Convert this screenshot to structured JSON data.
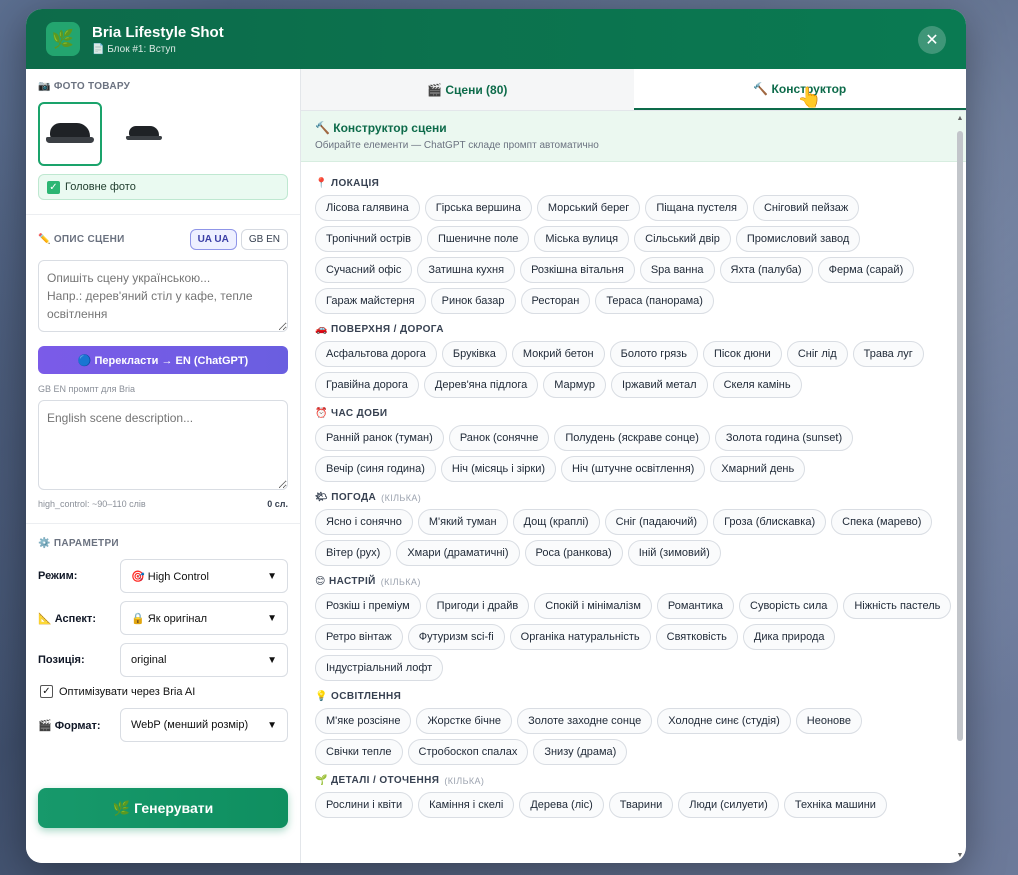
{
  "header": {
    "title": "Bria Lifestyle Shot",
    "subtitle": "📄 Блок #1: Вступ",
    "logo_icon": "🌿",
    "close_icon": "✕"
  },
  "left": {
    "photos_title": "📷 ФОТО ТОВАРУ",
    "main_photo_label": "Головне фото",
    "scene_title": "✏️ ОПИС СЦЕНИ",
    "lang_ua": "UA UA",
    "lang_en": "GB EN",
    "desc_placeholder": "Опишіть сцену українською...\nНапр.: дерев'яний стіл у кафе, тепле освітлення",
    "translate_label": "🔵 Перекласти → EN (ChatGPT)",
    "en_prompt_label": "GB EN промпт для Bria",
    "en_placeholder": "English scene description...",
    "hint": "high_control: ~90–110 слів",
    "word_count": "0 сл.",
    "params_title": "⚙️ ПАРАМЕТРИ",
    "mode_label": "Режим:",
    "mode_value": "🎯 High Control",
    "aspect_label": "📐 Аспект:",
    "aspect_value": "🔒 Як оригінал",
    "position_label": "Позиція:",
    "position_value": "original",
    "optimize_label": "Оптимізувати через Bria AI",
    "format_label": "🎬 Формат:",
    "format_value": "WebP (менший розмір)",
    "generate_label": "🌿 Генерувати"
  },
  "tabs": {
    "scenes": "🎬 Сцени (80)",
    "builder": "🔨 Конструктор"
  },
  "builder": {
    "title": "🔨 Конструктор сцени",
    "subtitle": "Обирайте елементи — ChatGPT складе промпт автоматично"
  },
  "categories": [
    {
      "title": "📍 ЛОКАЦІЯ",
      "note": "",
      "chips": [
        "Лісова галявина",
        "Гірська вершина",
        "Морський берег",
        "Піщана пустеля",
        "Сніговий пейзаж",
        "Тропічний острів",
        "Пшеничне поле",
        "Міська вулиця",
        "Сільський двір",
        "Промисловий завод",
        "Сучасний офіс",
        "Затишна кухня",
        "Розкішна вітальня",
        "Spa ванна",
        "Яхта (палуба)",
        "Ферма (сарай)",
        "Гараж майстерня",
        "Ринок базар",
        "Ресторан",
        "Тераса (панорама)"
      ]
    },
    {
      "title": "🚗 ПОВЕРХНЯ / ДОРОГА",
      "note": "",
      "chips": [
        "Асфальтова дорога",
        "Бруківка",
        "Мокрий бетон",
        "Болото грязь",
        "Пісок дюни",
        "Сніг лід",
        "Трава луг",
        "Гравійна дорога",
        "Дерев'яна підлога",
        "Мармур",
        "Іржавий метал",
        "Скеля камінь"
      ]
    },
    {
      "title": "⏰ ЧАС ДОБИ",
      "note": "",
      "chips": [
        "Ранній ранок (туман)",
        "Ранок (сонячне",
        "Полудень (яскраве сонце)",
        "Золота година (sunset)",
        "Вечір (синя година)",
        "Ніч (місяць і зірки)",
        "Ніч (штучне освітлення)",
        "Хмарний день"
      ]
    },
    {
      "title": "🌤 ПОГОДА",
      "note": "(КІЛЬКА)",
      "chips": [
        "Ясно і сонячно",
        "М'який туман",
        "Дощ (краплі)",
        "Сніг (падаючий)",
        "Гроза (блискавка)",
        "Спека (марево)",
        "Вітер (рух)",
        "Хмари (драматичні)",
        "Роса (ранкова)",
        "Іній (зимовий)"
      ]
    },
    {
      "title": "😊 НАСТРІЙ",
      "note": "(КІЛЬКА)",
      "chips": [
        "Розкіш і преміум",
        "Пригоди і драйв",
        "Спокій і мінімалізм",
        "Романтика",
        "Суворість сила",
        "Ніжність пастель",
        "Ретро вінтаж",
        "Футуризм sci-fi",
        "Органіка натуральність",
        "Святковість",
        "Дика природа",
        "Індустріальний лофт"
      ]
    },
    {
      "title": "💡 ОСВІТЛЕННЯ",
      "note": "",
      "chips": [
        "М'яке розсіяне",
        "Жорстке бічне",
        "Золоте заходне сонце",
        "Холодне синє (студія)",
        "Неонове",
        "Свічки тепле",
        "Стробоскоп спалах",
        "Знизу (драма)"
      ]
    },
    {
      "title": "🌱 ДЕТАЛІ / ОТОЧЕННЯ",
      "note": "(КІЛЬКА)",
      "chips": [
        "Рослини і квіти",
        "Каміння і скелі",
        "Дерева (ліс)",
        "Тварини",
        "Люди (силуети)",
        "Техніка машини"
      ]
    }
  ]
}
